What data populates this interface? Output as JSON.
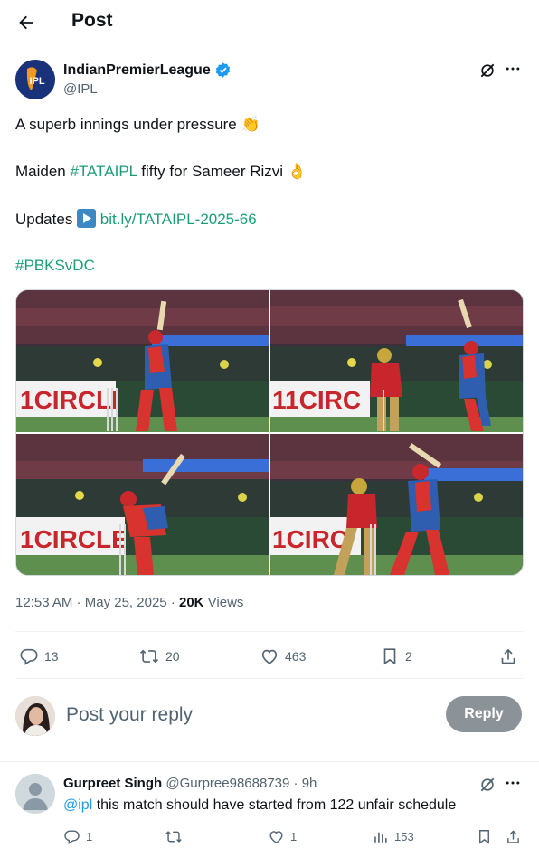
{
  "header": {
    "title": "Post",
    "back_icon": "arrow-left-icon"
  },
  "author": {
    "name": "IndianPremierLeague",
    "handle": "@IPL",
    "verified_color": "#1d9bf0",
    "avatar_text": "IPL"
  },
  "tweet": {
    "line1": "A superb innings under pressure",
    "line1_emoji": "👏",
    "line2_prefix": "Maiden ",
    "line2_hashtag": "#TATAIPL",
    "line2_suffix": " fifty for Sameer Rizvi",
    "line2_emoji": "👌",
    "line3_prefix": "Updates",
    "line3_emoji": "▶️",
    "line3_link": "bit.ly/TATAIPL-2025-66",
    "line4_hashtag": "#PBKSvDC"
  },
  "media": {
    "photos": [
      {
        "banner": "1CIRCLE"
      },
      {
        "banner": "11CIRC"
      },
      {
        "banner": "1CIRCLE"
      },
      {
        "banner": "1CIRC"
      }
    ]
  },
  "meta": {
    "time": "12:53 AM",
    "sep1": " · ",
    "date": "May 25, 2025",
    "sep2": " · ",
    "views_count": "20K",
    "views_label": " Views"
  },
  "actions": {
    "replies": "13",
    "reposts": "20",
    "likes": "463",
    "bookmarks": "2"
  },
  "reply_box": {
    "placeholder": "Post your reply",
    "button": "Reply"
  },
  "comment": {
    "name": "Gurpreet Singh",
    "handle": "@Gurpree98688739",
    "sep": " · ",
    "time": "9h",
    "mention": "@ipl",
    "text": " this match should have started from 122 unfair schedule",
    "replies": "1",
    "reposts": "",
    "likes": "1",
    "views": "153"
  },
  "colors": {
    "accent": "#1b9e77",
    "muted": "#536471",
    "reply_button": "#8b9298",
    "kit_red": "#d8332f",
    "kit_blue": "#2f5db0"
  }
}
